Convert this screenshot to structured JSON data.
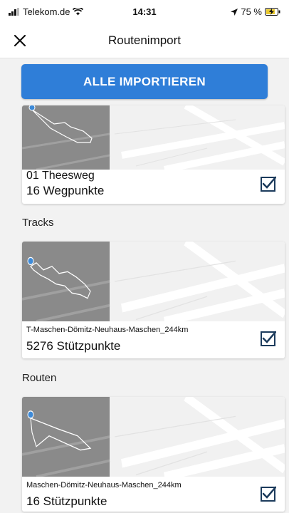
{
  "status": {
    "carrier": "Telekom.de",
    "time": "14:31",
    "battery": "75 %"
  },
  "nav": {
    "title": "Routenimport"
  },
  "import_all_label": "ALLE IMPORTIEREN",
  "waypoints": {
    "name": "01 Theesweg",
    "detail": "16 Wegpunkte",
    "checked": true
  },
  "tracks": {
    "section_label": "Tracks",
    "name": "T-Maschen-Dömitz-Neuhaus-Maschen_244km",
    "detail": "5276 Stützpunkte",
    "checked": true
  },
  "routes": {
    "section_label": "Routen",
    "name": "Maschen-Dömitz-Neuhaus-Maschen_244km",
    "detail": "16 Stützpunkte",
    "checked": true
  },
  "colors": {
    "accent": "#2f7ed8",
    "check": "#1c3b5c",
    "map_bg": "#8a8a8a"
  }
}
